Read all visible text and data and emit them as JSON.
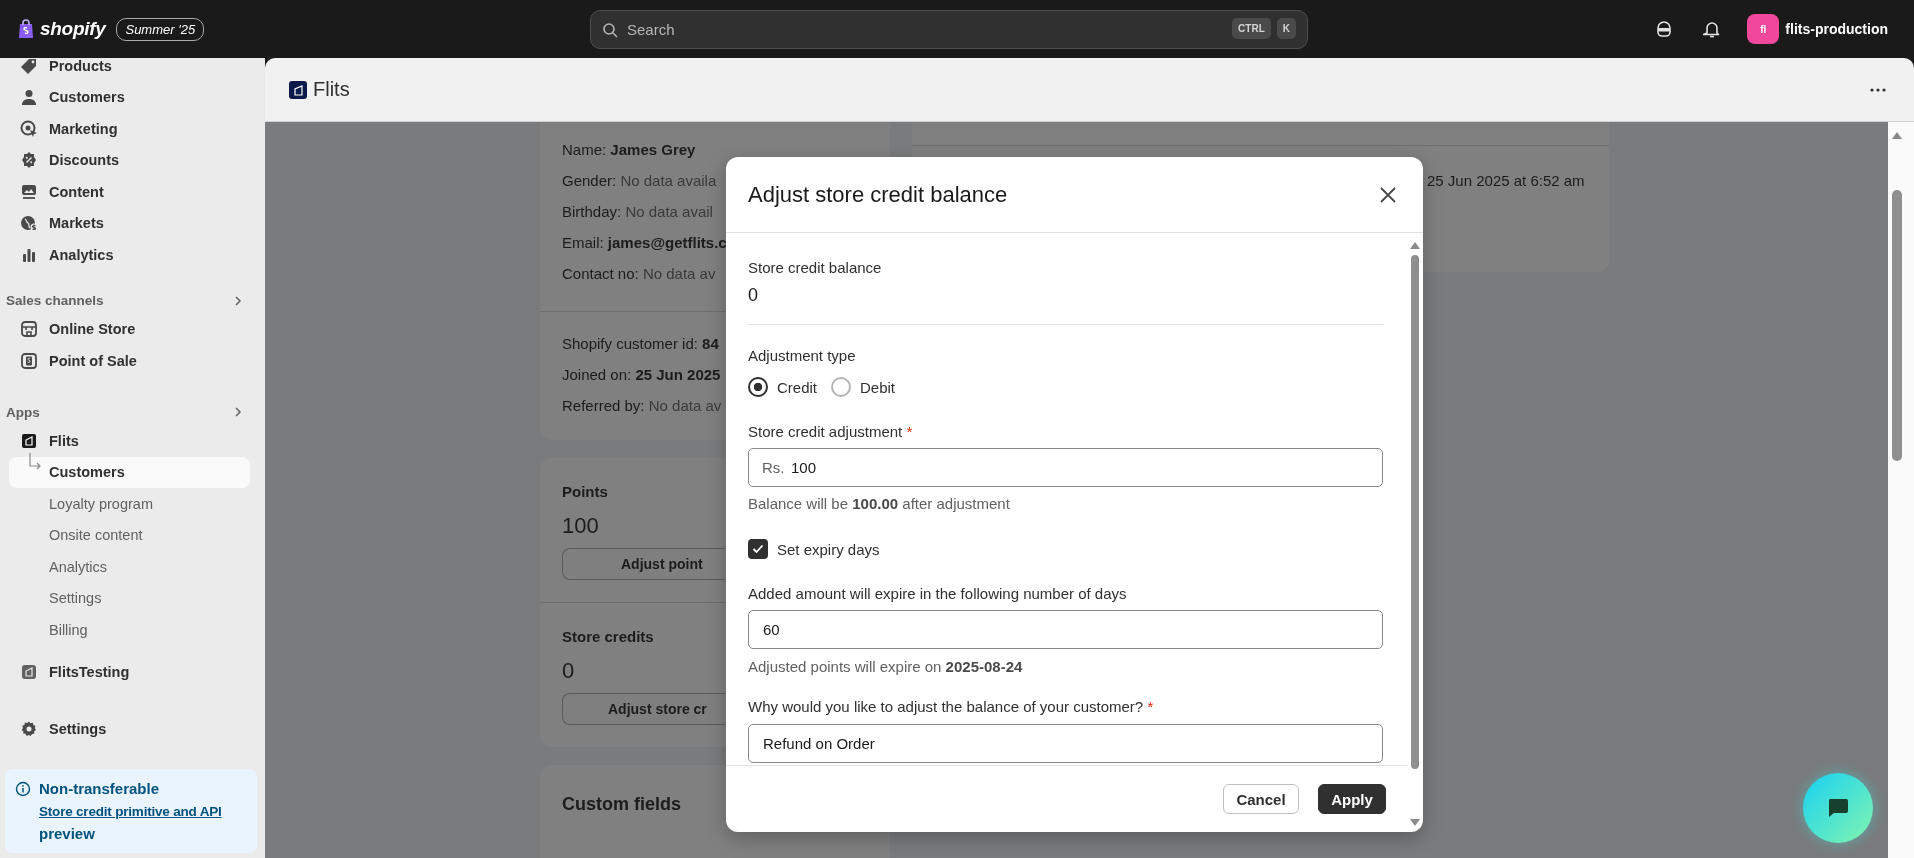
{
  "top_bar": {
    "brand": "shopify",
    "edition": "Summer '25",
    "search": {
      "placeholder": "Search",
      "shortcut": [
        "CTRL",
        "K"
      ]
    },
    "avatar": "fl",
    "store_name": "flits-production"
  },
  "sidebar": {
    "nav": [
      {
        "label": "Products"
      },
      {
        "label": "Customers"
      },
      {
        "label": "Marketing"
      },
      {
        "label": "Discounts"
      },
      {
        "label": "Content"
      },
      {
        "label": "Markets"
      },
      {
        "label": "Analytics"
      }
    ],
    "sections": [
      {
        "title": "Sales channels",
        "items": [
          {
            "label": "Online Store"
          },
          {
            "label": "Point of Sale"
          }
        ]
      },
      {
        "title": "Apps",
        "items": [
          {
            "label": "Flits",
            "children": [
              {
                "label": "Customers",
                "selected": true
              },
              {
                "label": "Loyalty program",
                "selected": false
              },
              {
                "label": "Onsite content",
                "selected": false
              },
              {
                "label": "Analytics",
                "selected": false
              },
              {
                "label": "Settings",
                "selected": false
              },
              {
                "label": "Billing",
                "selected": false
              }
            ]
          },
          {
            "label": "FlitsTesting"
          }
        ]
      }
    ],
    "settings": "Settings",
    "notice": {
      "title": "Non-transferable",
      "link": "Store credit primitive and API",
      "suffix": " preview"
    }
  },
  "app_header": {
    "title": "Flits"
  },
  "customer_card": {
    "details": [
      {
        "label": "Name: ",
        "value": "James Grey",
        "bold": true
      },
      {
        "label": "Gender: ",
        "value": "No data availa",
        "bold": false
      },
      {
        "label": "Birthday: ",
        "value": "No data avail",
        "bold": false
      },
      {
        "label": "Email: ",
        "value": "james@getflits.c",
        "bold": true
      },
      {
        "label": "Contact no: ",
        "value": "No data av",
        "bold": false
      }
    ],
    "meta": [
      {
        "label": "Shopify customer id: ",
        "value": "84",
        "bold": true
      },
      {
        "label": "Joined on: ",
        "value": "25 Jun 2025",
        "bold": true
      },
      {
        "label": "Referred by: ",
        "value": "No data av",
        "bold": false
      }
    ]
  },
  "balance_card": [
    {
      "title": "Points",
      "value": "100",
      "button": "Adjust point"
    },
    {
      "title": "Store credits",
      "value": "0",
      "button": "Adjust store cr"
    }
  ],
  "custom_fields_card": {
    "title": "Custom fields"
  },
  "activity_card": {
    "text": "25 Jun 2025 at 6:52 am"
  },
  "modal": {
    "title": "Adjust store credit balance",
    "balance": {
      "label": "Store credit balance",
      "value": "0"
    },
    "adjustment_type": {
      "label": "Adjustment type",
      "options": [
        {
          "label": "Credit",
          "selected": true
        },
        {
          "label": "Debit",
          "selected": false
        }
      ]
    },
    "amount": {
      "label": "Store credit adjustment",
      "required_mark": "*",
      "prefix": "Rs.",
      "value": "100",
      "help": "Balance will be **100.00** after adjustment"
    },
    "expiry": {
      "label": "Set expiry days",
      "checked": true
    },
    "days": {
      "label": "Added amount will expire in the following number of days",
      "value": "60",
      "help": "Adjusted points will expire on **2025-08-24**"
    },
    "reason": {
      "label": "Why would you like to adjust the balance of your customer?",
      "required_mark": "*",
      "value": "Refund on Order"
    },
    "buttons": [
      {
        "label": "Cancel",
        "kind": "secondary"
      },
      {
        "label": "Apply",
        "kind": "primary"
      }
    ]
  }
}
